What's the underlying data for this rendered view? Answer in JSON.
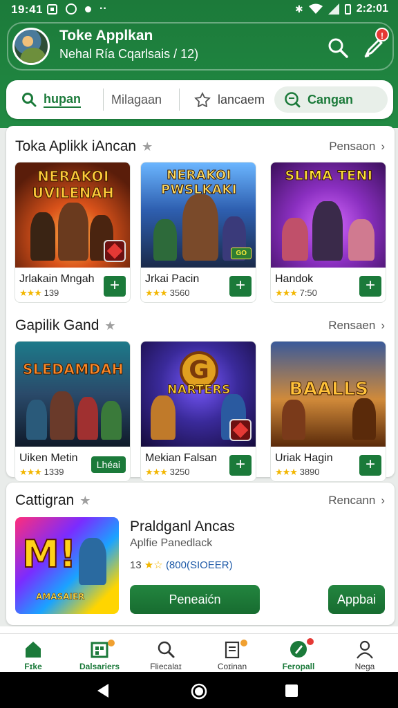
{
  "status_bar": {
    "time": "19:41",
    "right_time": "2:2:01"
  },
  "header": {
    "title": "Toke Applkan",
    "subtitle": "Nehal Ría Cqarlsais / 12)",
    "badge_count": "!"
  },
  "search_tabs": [
    {
      "label": "hupan",
      "icon": "search-icon"
    },
    {
      "label": "Milagaan",
      "icon": ""
    },
    {
      "label": "lancaem",
      "icon": "puzzle-icon"
    },
    {
      "label": "Cangan",
      "icon": "chat-search-icon"
    }
  ],
  "sections": [
    {
      "title": "Toka Aplikk iAncan",
      "more": "Pensaon",
      "items": [
        {
          "name": "Jrlakain Mngah",
          "rating": "139",
          "art_title": "NERAKOI UVILENAH",
          "action": "+"
        },
        {
          "name": "Jrkai Pacin",
          "rating": "3560",
          "art_title": "NERAKOI PWSLKAKI",
          "action": "+"
        },
        {
          "name": "Handok",
          "rating": "7:50",
          "art_title": "SLIMA TENI",
          "action": "+"
        }
      ]
    },
    {
      "title": "Gapilik Gand",
      "more": "Rensaen",
      "items": [
        {
          "name": "Uiken Metin",
          "rating": "1339",
          "art_title": "SLEDAMDAH",
          "action": "Lhéai"
        },
        {
          "name": "Mekian Falsan",
          "rating": "3250",
          "art_title": "NARTERS",
          "action": "+"
        },
        {
          "name": "Uriak Hagin",
          "rating": "3890",
          "art_title": "BAALLS",
          "action": "+"
        }
      ]
    }
  ],
  "featured": {
    "section_title": "Cattigran",
    "more": "Rencann",
    "title": "Praldganl Ancas",
    "subtitle": "Aplfie Panedlack",
    "rating": "13",
    "rating_link": "(800(SIOEER)",
    "art_logo": "M!",
    "art_caption": "AMASAIER",
    "primary_button": "Peneaićn",
    "secondary_button": "Appbai"
  },
  "bottom_nav": [
    {
      "label": "Fɪke",
      "icon": "home-icon"
    },
    {
      "label": "Dalsariers",
      "icon": "apps-icon"
    },
    {
      "label": "Fliecalaɪ",
      "icon": "search-icon"
    },
    {
      "label": "Coɪinan",
      "icon": "document-icon"
    },
    {
      "label": "Feropall",
      "icon": "rocket-icon"
    },
    {
      "label": "Negа",
      "icon": "person-icon"
    }
  ],
  "colors": {
    "primary": "#1b7a3a",
    "star": "#f2b600",
    "badge": "#e53935"
  }
}
